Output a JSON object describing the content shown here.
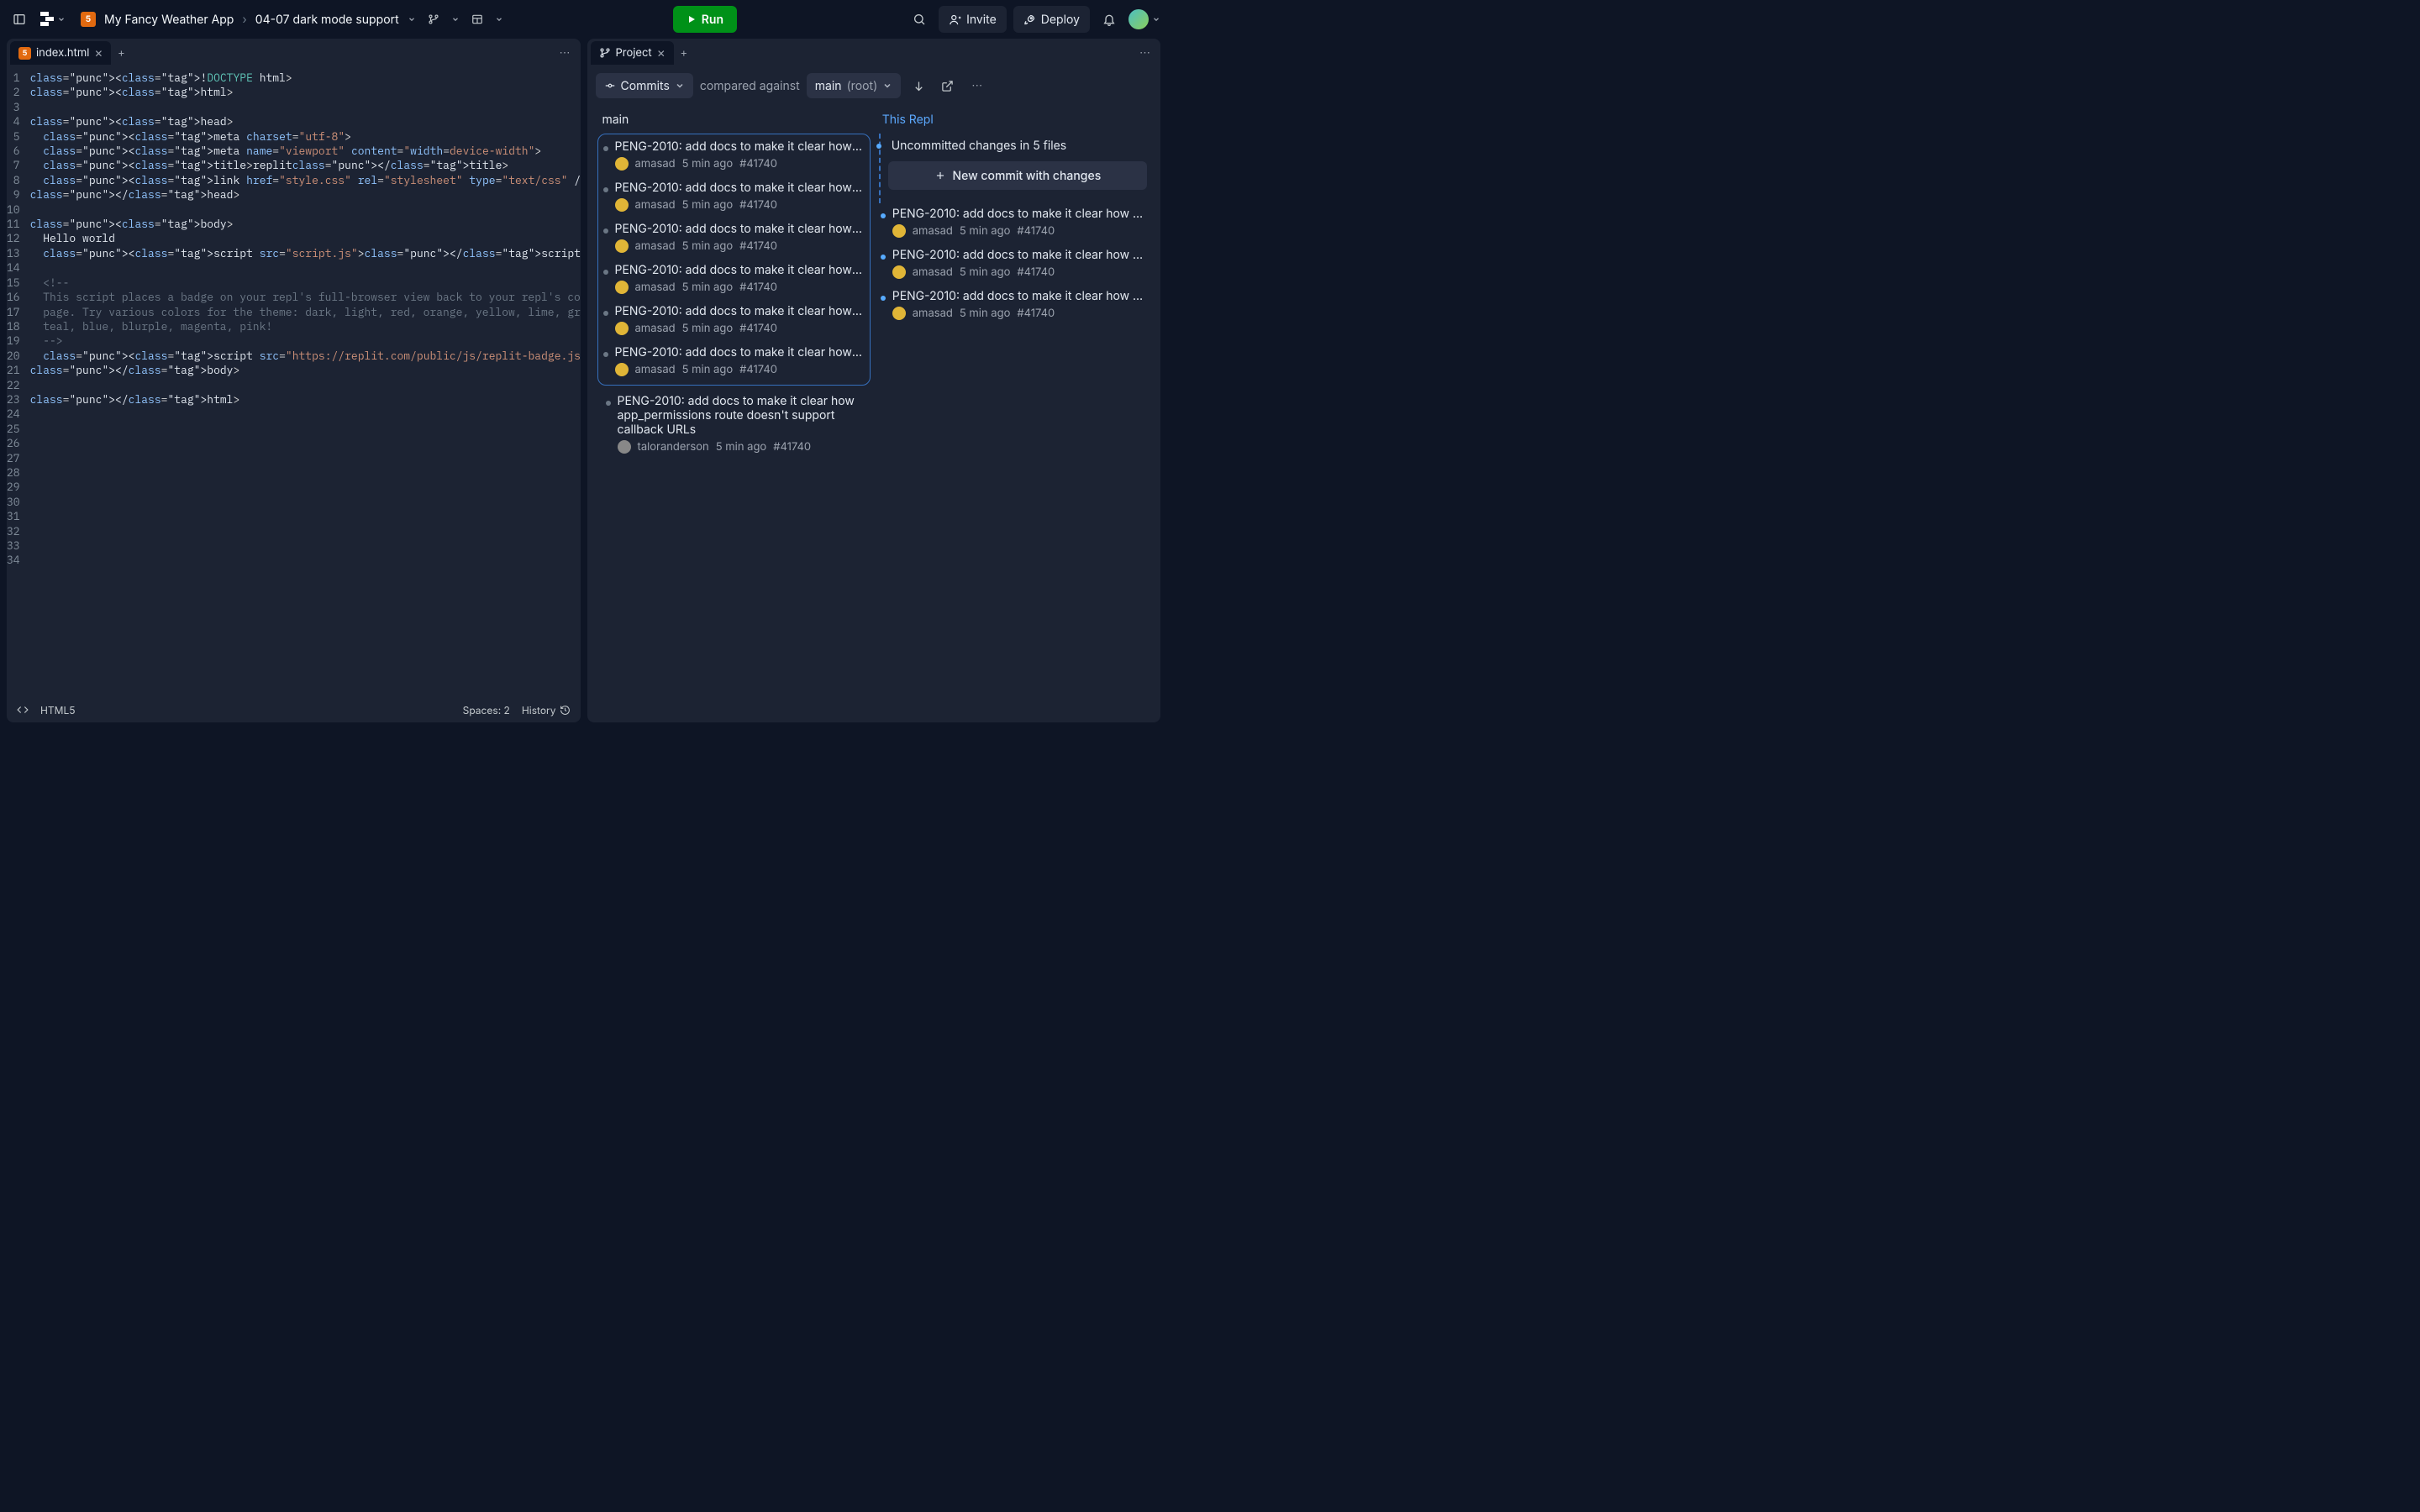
{
  "header": {
    "project_name": "My Fancy Weather App",
    "branch_name": "04-07 dark mode support",
    "run_label": "Run",
    "invite_label": "Invite",
    "deploy_label": "Deploy"
  },
  "editor": {
    "tab_label": "index.html",
    "status_lang": "HTML5",
    "status_spaces": "Spaces: 2",
    "status_history": "History",
    "lines": [
      "<!DOCTYPE html>",
      "<html>",
      "",
      "<head>",
      "  <meta charset=\"utf-8\">",
      "  <meta name=\"viewport\" content=\"width=device-width\">",
      "  <title>replit</title>",
      "  <link href=\"style.css\" rel=\"stylesheet\" type=\"text/css\" />",
      "</head>",
      "",
      "<body>",
      "  Hello world",
      "  <script src=\"script.js\"></script>",
      "",
      "  <!--",
      "  This script places a badge on your repl's full-browser view back to your repl's cover",
      "  page. Try various colors for the theme: dark, light, red, orange, yellow, lime, green,",
      "  teal, blue, blurple, magenta, pink!",
      "  -->",
      "  <script src=\"https://replit.com/public/js/replit-badge.js\" theme=\"blue\" defer></script>",
      "</body>",
      "",
      "</html>",
      ""
    ],
    "line_count": 34
  },
  "project": {
    "tab_label": "Project",
    "dropdown_label": "Commits",
    "compare_label": "compared against",
    "branch_select_name": "main",
    "branch_select_suffix": "(root)",
    "left_col_title": "main",
    "right_col_title": "This Repl",
    "uncommitted_label": "Uncommitted changes in 5 files",
    "new_commit_label": "New commit with changes",
    "commit_title": "PENG-2010: add docs to make it clear how app_permissions route doesn't support callback URLs",
    "commit_title_trunc": "PENG-2010: add docs to make it clear how app_p...",
    "author_a": "amasad",
    "author_b": "taloranderson",
    "time_ago": "5 min ago",
    "hash": "#41740",
    "left_commits": [
      0,
      1,
      2,
      3,
      4,
      5
    ],
    "right_commits": [
      0,
      1,
      2
    ]
  }
}
